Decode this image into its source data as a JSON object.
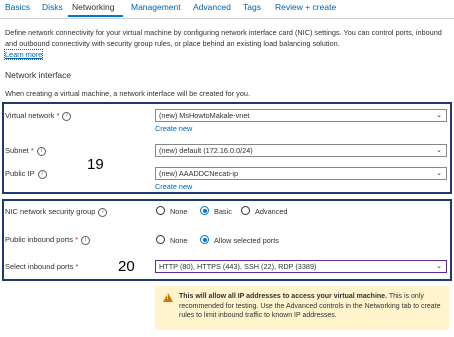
{
  "tabs": [
    "Basics",
    "Disks",
    "Networking",
    "Management",
    "Advanced",
    "Tags",
    "Review + create"
  ],
  "active_tab": "Networking",
  "description": {
    "text": "Define network connectivity for your virtual machine by configuring network interface card (NIC) settings. You can control ports, inbound and outbound connectivity with security group rules, or place behind an existing load balancing solution.",
    "learn_more": "Learn more"
  },
  "network_interface": {
    "title": "Network interface",
    "subtitle": "When creating a virtual machine, a network interface will be created for you."
  },
  "fields": {
    "virtual_network": {
      "label": "Virtual network",
      "value": "(new) MsHowtoMakale-vnet",
      "create_new": "Create new"
    },
    "subnet": {
      "label": "Subnet",
      "value": "(new) default (172.16.0.0/24)"
    },
    "public_ip": {
      "label": "Public IP",
      "value": "(new) AAADDCNecati-ip",
      "create_new": "Create new"
    },
    "nic_nsg": {
      "label": "NIC network security group",
      "options": [
        "None",
        "Basic",
        "Advanced"
      ],
      "selected": "Basic"
    },
    "public_inbound_ports": {
      "label": "Public inbound ports",
      "options": [
        "None",
        "Allow selected ports"
      ],
      "selected": "Allow selected ports"
    },
    "select_inbound_ports": {
      "label": "Select inbound ports",
      "value": "HTTP (80), HTTPS (443), SSH (22), RDP (3389)"
    }
  },
  "required_marker": "*",
  "annotations": {
    "box1": "19",
    "box2": "20"
  },
  "warning": {
    "bold": "This will allow all IP addresses to access your virtual machine.",
    "text": " This is only recommended for testing.  Use the Advanced controls in the Networking tab to create rules to limit inbound traffic to known IP addresses."
  },
  "icons": {
    "info": "info-icon",
    "chevron": "chevron-down-icon",
    "warning": "warning-icon"
  }
}
